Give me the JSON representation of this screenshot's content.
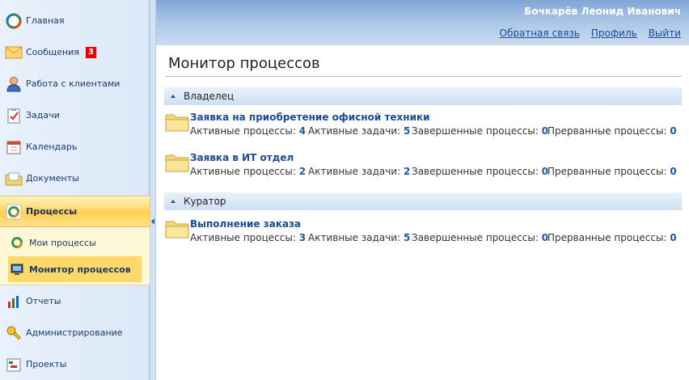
{
  "sidebar": {
    "items": [
      {
        "label": "Главная",
        "icon": "home-icon"
      },
      {
        "label": "Сообщения",
        "icon": "envelope-icon",
        "badge": "3"
      },
      {
        "label": "Работа с клиентами",
        "icon": "user-icon"
      },
      {
        "label": "Задачи",
        "icon": "tasks-icon"
      },
      {
        "label": "Календарь",
        "icon": "calendar-icon"
      },
      {
        "label": "Документы",
        "icon": "documents-icon"
      },
      {
        "label": "Процессы",
        "icon": "processes-icon"
      },
      {
        "label": "Отчеты",
        "icon": "reports-icon"
      },
      {
        "label": "Администрирование",
        "icon": "admin-key-icon"
      },
      {
        "label": "Проекты",
        "icon": "projects-icon"
      }
    ],
    "submenu": [
      {
        "label": "Мои процессы",
        "icon": "my-processes-icon"
      },
      {
        "label": "Монитор процессов",
        "icon": "monitor-icon"
      }
    ]
  },
  "header": {
    "user_name": "Бочкарёв Леонид Иванович",
    "links": [
      "Обратная связь",
      "Профиль",
      "Выйти"
    ]
  },
  "main": {
    "title": "Монитор процессов",
    "labels": {
      "active_processes": "Активные процессы:",
      "active_tasks": "Активные задачи:",
      "completed_processes": "Завершенные процессы:",
      "interrupted_processes": "Прерванные процессы:"
    },
    "groups": [
      {
        "name": "Владелец",
        "processes": [
          {
            "title": "Заявка на приобретение офисной техники",
            "active_processes": "4",
            "active_tasks": "5",
            "completed_processes": "0",
            "interrupted_processes": "0"
          },
          {
            "title": "Заявка в ИТ отдел",
            "active_processes": "2",
            "active_tasks": "2",
            "completed_processes": "0",
            "interrupted_processes": "0"
          }
        ]
      },
      {
        "name": "Куратор",
        "processes": [
          {
            "title": "Выполнение заказа",
            "active_processes": "3",
            "active_tasks": "5",
            "completed_processes": "0",
            "interrupted_processes": "0"
          }
        ]
      }
    ]
  }
}
